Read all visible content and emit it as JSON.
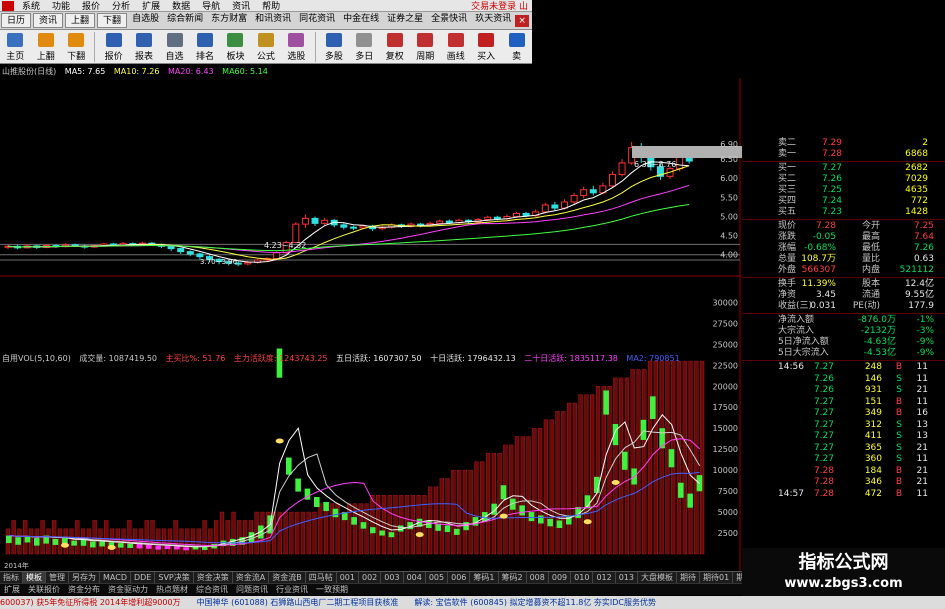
{
  "menubar": {
    "items": [
      "系统",
      "功能",
      "报价",
      "分析",
      "扩展",
      "数据",
      "导航",
      "资讯",
      "帮助"
    ],
    "right_text": "交易未登录  山"
  },
  "tabrow": {
    "tabs": [
      "日历",
      "资讯",
      "上翻",
      "下翻",
      "自选股",
      "综合新闻",
      "东方财富",
      "和讯资讯",
      "同花资讯",
      "中金在线",
      "证券之星",
      "全景快讯",
      "玖天资讯"
    ]
  },
  "toolbar": {
    "tools": [
      {
        "label": "主页",
        "icon": "home-icon",
        "color": "#3a70c0"
      },
      {
        "label": "上翻",
        "icon": "arrow-up-icon",
        "color": "#e08a10"
      },
      {
        "label": "下翻",
        "icon": "arrow-down-icon",
        "color": "#e08a10"
      },
      {
        "label": "报价",
        "icon": "quote-icon",
        "color": "#3060b0"
      },
      {
        "label": "报表",
        "icon": "report-icon",
        "color": "#3060b0"
      },
      {
        "label": "自选",
        "icon": "watchlist-icon",
        "color": "#607080"
      },
      {
        "label": "排名",
        "icon": "ranking-icon",
        "color": "#3060b0"
      },
      {
        "label": "板块",
        "icon": "sector-icon",
        "color": "#3a9040"
      },
      {
        "label": "公式",
        "icon": "formula-icon",
        "color": "#c09020"
      },
      {
        "label": "选股",
        "icon": "stock-picker-icon",
        "color": "#a050a0"
      },
      {
        "label": "多股",
        "icon": "multi-stock-icon",
        "color": "#3060b0"
      },
      {
        "label": "多日",
        "icon": "multi-day-icon",
        "color": "#909090"
      },
      {
        "label": "复权",
        "icon": "adjust-icon",
        "color": "#c03030"
      },
      {
        "label": "周期",
        "icon": "period-icon",
        "color": "#c03030"
      },
      {
        "label": "画线",
        "icon": "draw-line-icon",
        "color": "#c03030"
      },
      {
        "label": "买入",
        "icon": "buy-icon",
        "color": "#c02020"
      },
      {
        "label": "卖",
        "icon": "sell-icon",
        "color": "#2060c0"
      }
    ]
  },
  "ma_legend": {
    "name": "山推股份(日线)",
    "ma5": "MA5: 7.65",
    "ma10": "MA10: 7.26",
    "ma20": "MA20: 6.43",
    "ma60": "MA60: 5.14",
    "colors": {
      "ma5": "#ffffff",
      "ma10": "#ffff40",
      "ma20": "#ff40ff",
      "ma60": "#40ff40"
    }
  },
  "price_chart": {
    "y_ticks": [
      "6.90",
      "6.50",
      "6.00",
      "5.50",
      "5.00",
      "4.50",
      "4.00"
    ],
    "annotation_high": "6.38~8.76",
    "annotation_mid": "4.23~4.32",
    "annotation_low": "3.70~3.96",
    "candles": [
      {
        "o": 4.2,
        "c": 4.22,
        "h": 4.25,
        "l": 4.15
      },
      {
        "o": 4.22,
        "c": 4.18,
        "h": 4.26,
        "l": 4.14
      },
      {
        "o": 4.18,
        "c": 4.23,
        "h": 4.27,
        "l": 4.16
      },
      {
        "o": 4.23,
        "c": 4.19,
        "h": 4.26,
        "l": 4.15
      },
      {
        "o": 4.19,
        "c": 4.24,
        "h": 4.28,
        "l": 4.17
      },
      {
        "o": 4.24,
        "c": 4.21,
        "h": 4.27,
        "l": 4.18
      },
      {
        "o": 4.21,
        "c": 4.26,
        "h": 4.3,
        "l": 4.19
      },
      {
        "o": 4.26,
        "c": 4.23,
        "h": 4.29,
        "l": 4.2
      },
      {
        "o": 4.23,
        "c": 4.2,
        "h": 4.26,
        "l": 4.16
      },
      {
        "o": 4.2,
        "c": 4.24,
        "h": 4.27,
        "l": 4.18
      },
      {
        "o": 4.24,
        "c": 4.28,
        "h": 4.31,
        "l": 4.22
      },
      {
        "o": 4.28,
        "c": 4.25,
        "h": 4.31,
        "l": 4.22
      },
      {
        "o": 4.25,
        "c": 4.29,
        "h": 4.33,
        "l": 4.23
      },
      {
        "o": 4.29,
        "c": 4.26,
        "h": 4.32,
        "l": 4.23
      },
      {
        "o": 4.26,
        "c": 4.3,
        "h": 4.34,
        "l": 4.24
      },
      {
        "o": 4.3,
        "c": 4.27,
        "h": 4.33,
        "l": 4.24
      },
      {
        "o": 4.27,
        "c": 4.22,
        "h": 4.29,
        "l": 4.18
      },
      {
        "o": 4.22,
        "c": 4.16,
        "h": 4.24,
        "l": 4.1
      },
      {
        "o": 4.16,
        "c": 4.08,
        "h": 4.18,
        "l": 4.02
      },
      {
        "o": 4.08,
        "c": 4.02,
        "h": 4.11,
        "l": 3.96
      },
      {
        "o": 4.02,
        "c": 3.95,
        "h": 4.05,
        "l": 3.88
      },
      {
        "o": 3.95,
        "c": 3.88,
        "h": 3.98,
        "l": 3.8
      },
      {
        "o": 3.88,
        "c": 3.82,
        "h": 3.91,
        "l": 3.75
      },
      {
        "o": 3.82,
        "c": 3.78,
        "h": 3.86,
        "l": 3.72
      },
      {
        "o": 3.78,
        "c": 3.76,
        "h": 3.82,
        "l": 3.7
      },
      {
        "o": 3.76,
        "c": 3.8,
        "h": 3.84,
        "l": 3.72
      },
      {
        "o": 3.8,
        "c": 3.86,
        "h": 3.89,
        "l": 3.77
      },
      {
        "o": 3.86,
        "c": 3.9,
        "h": 3.94,
        "l": 3.83
      },
      {
        "o": 3.9,
        "c": 4.05,
        "h": 4.09,
        "l": 3.88
      },
      {
        "o": 4.05,
        "c": 4.32,
        "h": 4.36,
        "l": 4.02
      },
      {
        "o": 4.32,
        "c": 4.8,
        "h": 4.85,
        "l": 4.3
      },
      {
        "o": 4.8,
        "c": 4.95,
        "h": 5.05,
        "l": 4.7
      },
      {
        "o": 4.95,
        "c": 4.82,
        "h": 5.0,
        "l": 4.75
      },
      {
        "o": 4.82,
        "c": 4.9,
        "h": 4.96,
        "l": 4.78
      },
      {
        "o": 4.9,
        "c": 4.78,
        "h": 4.93,
        "l": 4.72
      },
      {
        "o": 4.78,
        "c": 4.72,
        "h": 4.82,
        "l": 4.66
      },
      {
        "o": 4.72,
        "c": 4.7,
        "h": 4.76,
        "l": 4.64
      },
      {
        "o": 4.7,
        "c": 4.75,
        "h": 4.79,
        "l": 4.66
      },
      {
        "o": 4.75,
        "c": 4.68,
        "h": 4.78,
        "l": 4.62
      },
      {
        "o": 4.68,
        "c": 4.72,
        "h": 4.76,
        "l": 4.64
      },
      {
        "o": 4.72,
        "c": 4.78,
        "h": 4.82,
        "l": 4.68
      },
      {
        "o": 4.78,
        "c": 4.74,
        "h": 4.81,
        "l": 4.7
      },
      {
        "o": 4.74,
        "c": 4.8,
        "h": 4.84,
        "l": 4.71
      },
      {
        "o": 4.8,
        "c": 4.76,
        "h": 4.83,
        "l": 4.72
      },
      {
        "o": 4.76,
        "c": 4.82,
        "h": 4.86,
        "l": 4.73
      },
      {
        "o": 4.82,
        "c": 4.88,
        "h": 4.92,
        "l": 4.79
      },
      {
        "o": 4.88,
        "c": 4.84,
        "h": 4.92,
        "l": 4.8
      },
      {
        "o": 4.84,
        "c": 4.9,
        "h": 4.94,
        "l": 4.81
      },
      {
        "o": 4.9,
        "c": 4.86,
        "h": 4.93,
        "l": 4.82
      },
      {
        "o": 4.86,
        "c": 4.92,
        "h": 4.96,
        "l": 4.83
      },
      {
        "o": 4.92,
        "c": 4.98,
        "h": 5.02,
        "l": 4.88
      },
      {
        "o": 4.98,
        "c": 4.94,
        "h": 5.02,
        "l": 4.9
      },
      {
        "o": 4.94,
        "c": 5.0,
        "h": 5.05,
        "l": 4.91
      },
      {
        "o": 5.0,
        "c": 5.08,
        "h": 5.12,
        "l": 4.97
      },
      {
        "o": 5.08,
        "c": 5.02,
        "h": 5.12,
        "l": 4.98
      },
      {
        "o": 5.02,
        "c": 5.12,
        "h": 5.18,
        "l": 4.99
      },
      {
        "o": 5.12,
        "c": 5.3,
        "h": 5.36,
        "l": 5.08
      },
      {
        "o": 5.3,
        "c": 5.22,
        "h": 5.38,
        "l": 5.15
      },
      {
        "o": 5.22,
        "c": 5.38,
        "h": 5.45,
        "l": 5.18
      },
      {
        "o": 5.38,
        "c": 5.55,
        "h": 5.62,
        "l": 5.32
      },
      {
        "o": 5.55,
        "c": 5.7,
        "h": 5.78,
        "l": 5.48
      },
      {
        "o": 5.7,
        "c": 5.62,
        "h": 5.8,
        "l": 5.55
      },
      {
        "o": 5.62,
        "c": 5.8,
        "h": 5.88,
        "l": 5.58
      },
      {
        "o": 5.8,
        "c": 6.1,
        "h": 6.18,
        "l": 5.76
      },
      {
        "o": 6.1,
        "c": 6.4,
        "h": 6.5,
        "l": 6.05
      },
      {
        "o": 6.4,
        "c": 6.8,
        "h": 6.95,
        "l": 6.35
      },
      {
        "o": 6.8,
        "c": 6.55,
        "h": 6.92,
        "l": 6.4
      },
      {
        "o": 6.55,
        "c": 6.3,
        "h": 6.62,
        "l": 6.2
      },
      {
        "o": 6.3,
        "c": 6.05,
        "h": 6.38,
        "l": 5.95
      },
      {
        "o": 6.05,
        "c": 6.25,
        "h": 6.32,
        "l": 5.98
      },
      {
        "o": 6.25,
        "c": 6.58,
        "h": 6.66,
        "l": 6.18
      },
      {
        "o": 6.58,
        "c": 6.45,
        "h": 6.7,
        "l": 6.38
      }
    ]
  },
  "volume_legend": {
    "name": "自用VOL(5,10,60)",
    "vol": "成交量: 1087419.50",
    "buy_ratio": "主买比%: 51.76",
    "active": "主力活跃度: 1243743.25",
    "five_day": "五日活跃: 1607307.50",
    "ten_day": "十日活跃: 1796432.13",
    "twenty_day": "二十日活跃: 1835117.38",
    "ma2": "MA2: 790851"
  },
  "volume_chart": {
    "y_ticks": [
      "30000",
      "27500",
      "25000",
      "22500",
      "20000",
      "17500",
      "15000",
      "12500",
      "10000",
      "7500",
      "5000",
      "2500"
    ],
    "x_label": "2014年",
    "red_bars": [
      3,
      4,
      3,
      4,
      3,
      3,
      4,
      3,
      4,
      3,
      3,
      3,
      4,
      3,
      3,
      4,
      3,
      4,
      3,
      3,
      3,
      4,
      3,
      3,
      4,
      4,
      3,
      3,
      3,
      4,
      3,
      3,
      3,
      3,
      4,
      3,
      4,
      5,
      4,
      5,
      4,
      4,
      4,
      5,
      5,
      5,
      5,
      5,
      5,
      5,
      5,
      5,
      5,
      5,
      6,
      6,
      6,
      6,
      5,
      6,
      6,
      6,
      6,
      7,
      7,
      7,
      7,
      7,
      7,
      7,
      7,
      7,
      7,
      8,
      8,
      9,
      9,
      10,
      10,
      10,
      10,
      11,
      11,
      12,
      12,
      12,
      13,
      13,
      14,
      14,
      14,
      15,
      15,
      16,
      16,
      17,
      17,
      18,
      18,
      19,
      19,
      19,
      20,
      20,
      20,
      21,
      21,
      21,
      22,
      22,
      22,
      23,
      23,
      23,
      23,
      23,
      23,
      23,
      23,
      23,
      23
    ],
    "green_bars": [
      {
        "v": 2.2,
        "h": 1.5
      },
      {
        "v": 2.0,
        "h": 1.5
      },
      {
        "v": 2.1,
        "h": 1.2
      },
      {
        "v": 1.9,
        "h": 1.5
      },
      {
        "v": 2.2,
        "h": 1.6
      },
      {
        "v": 1.8,
        "h": 1.2
      },
      {
        "v": 1.9,
        "h": 1.4
      },
      {
        "v": 1.6,
        "h": 1.0
      },
      {
        "v": 1.7,
        "h": 1.2
      },
      {
        "v": 1.5,
        "h": 1.2
      },
      {
        "v": 1.5,
        "h": 1.0
      },
      {
        "v": 1.4,
        "h": 1.0
      },
      {
        "v": 1.3,
        "h": 0.9
      },
      {
        "v": 1.2,
        "h": 0.8
      },
      {
        "v": 1.2,
        "h": 0.9
      },
      {
        "v": 1.1,
        "h": 0.8
      },
      {
        "v": 1.0,
        "h": 0.8
      },
      {
        "v": 1.0,
        "h": 0.7
      },
      {
        "v": 0.9,
        "h": 0.6
      },
      {
        "v": 0.8,
        "h": 0.6
      },
      {
        "v": 0.9,
        "h": 0.6
      },
      {
        "v": 0.9,
        "h": 0.7
      },
      {
        "v": 1.2,
        "h": 0.9
      },
      {
        "v": 1.6,
        "h": 1.1
      },
      {
        "v": 1.8,
        "h": 1.4
      },
      {
        "v": 2.0,
        "h": 1.5
      },
      {
        "v": 2.6,
        "h": 2.0
      },
      {
        "v": 3.4,
        "h": 2.6
      },
      {
        "v": 4.6,
        "h": 3.6
      },
      {
        "v": 24.5,
        "h": 5.8
      },
      {
        "v": 11.5,
        "h": 3.4
      },
      {
        "v": 9.0,
        "h": 2.6
      },
      {
        "v": 7.8,
        "h": 2.2
      },
      {
        "v": 6.8,
        "h": 2.0
      },
      {
        "v": 6.2,
        "h": 1.8
      },
      {
        "v": 5.4,
        "h": 1.7
      },
      {
        "v": 5.0,
        "h": 1.6
      },
      {
        "v": 4.4,
        "h": 1.5
      },
      {
        "v": 3.8,
        "h": 1.3
      },
      {
        "v": 3.2,
        "h": 1.2
      },
      {
        "v": 2.8,
        "h": 1.0
      },
      {
        "v": 2.6,
        "h": 1.0
      },
      {
        "v": 3.4,
        "h": 1.2
      },
      {
        "v": 3.8,
        "h": 1.4
      },
      {
        "v": 4.2,
        "h": 1.6
      },
      {
        "v": 4.0,
        "h": 1.5
      },
      {
        "v": 3.6,
        "h": 1.4
      },
      {
        "v": 3.4,
        "h": 1.3
      },
      {
        "v": 3.0,
        "h": 1.2
      },
      {
        "v": 3.8,
        "h": 1.6
      },
      {
        "v": 4.4,
        "h": 1.7
      },
      {
        "v": 5.0,
        "h": 1.9
      },
      {
        "v": 6.0,
        "h": 2.2
      },
      {
        "v": 8.2,
        "h": 2.8
      },
      {
        "v": 6.6,
        "h": 2.2
      },
      {
        "v": 5.8,
        "h": 2.0
      },
      {
        "v": 5.0,
        "h": 1.8
      },
      {
        "v": 4.6,
        "h": 1.6
      },
      {
        "v": 4.2,
        "h": 1.5
      },
      {
        "v": 4.0,
        "h": 1.5
      },
      {
        "v": 4.6,
        "h": 1.8
      },
      {
        "v": 5.6,
        "h": 2.2
      },
      {
        "v": 7.0,
        "h": 2.6
      },
      {
        "v": 9.2,
        "h": 3.2
      },
      {
        "v": 19.5,
        "h": 4.8
      },
      {
        "v": 15.5,
        "h": 4.2
      },
      {
        "v": 12.2,
        "h": 3.6
      },
      {
        "v": 10.2,
        "h": 3.2
      },
      {
        "v": 16.0,
        "h": 4.0
      },
      {
        "v": 18.8,
        "h": 4.5
      },
      {
        "v": 15.0,
        "h": 4.0
      },
      {
        "v": 12.5,
        "h": 3.6
      },
      {
        "v": 8.5,
        "h": 3.0
      },
      {
        "v": 7.2,
        "h": 2.8
      },
      {
        "v": 9.4,
        "h": 3.2
      }
    ],
    "magenta_bars_idx": [
      14,
      15,
      16,
      17,
      18,
      19
    ]
  },
  "quote_panel": {
    "asks": [
      {
        "label": "卖二",
        "price": "7.29",
        "vol": "2"
      },
      {
        "label": "卖一",
        "price": "7.28",
        "vol": "6868"
      }
    ],
    "bids": [
      {
        "label": "买一",
        "price": "7.27",
        "vol": "2682"
      },
      {
        "label": "买二",
        "price": "7.26",
        "vol": "7029"
      },
      {
        "label": "买三",
        "price": "7.25",
        "vol": "4635"
      },
      {
        "label": "买四",
        "price": "7.24",
        "vol": "772"
      },
      {
        "label": "买五",
        "price": "7.23",
        "vol": "1428"
      }
    ],
    "stats": [
      {
        "k": "现价",
        "v": "7.28",
        "k2": "今开",
        "v2": "7.25",
        "c1": "red",
        "c2": "red"
      },
      {
        "k": "涨跌",
        "v": "-0.05",
        "k2": "最高",
        "v2": "7.64",
        "c1": "green",
        "c2": "red"
      },
      {
        "k": "涨幅",
        "v": "-0.68%",
        "k2": "最低",
        "v2": "7.26",
        "c1": "green",
        "c2": "green"
      },
      {
        "k": "总量",
        "v": "108.7万",
        "k2": "量比",
        "v2": "0.63",
        "c1": "yellow",
        "c2": "white"
      },
      {
        "k": "外盘",
        "v": "566307",
        "k2": "内盘",
        "v2": "521112",
        "c1": "red",
        "c2": "green"
      }
    ],
    "stats2": [
      {
        "k": "换手",
        "v": "11.39%",
        "k2": "股本",
        "v2": "12.4亿",
        "c1": "yellow",
        "c2": "white"
      },
      {
        "k": "净资",
        "v": "3.45",
        "k2": "流通",
        "v2": "9.55亿",
        "c1": "white",
        "c2": "white"
      },
      {
        "k": "收益(三)",
        "v": "0.031",
        "k2": "PE(动)",
        "v2": "177.9",
        "c1": "white",
        "c2": "white"
      }
    ],
    "flows": [
      {
        "k": "净流入额",
        "v": "-876.0万",
        "p": "-1%"
      },
      {
        "k": "大宗流入",
        "v": "-2132万",
        "p": "-3%"
      },
      {
        "k": "5日净流入额",
        "v": "-4.63亿",
        "p": "-9%"
      },
      {
        "k": "5日大宗流入",
        "v": "-4.53亿",
        "p": "-9%"
      }
    ],
    "ticks": [
      {
        "t": "14:56",
        "p": "7.27",
        "v": "248",
        "s": "B",
        "n": "11",
        "pc": "green",
        "sc": "red"
      },
      {
        "t": "",
        "p": "7.26",
        "v": "146",
        "s": "S",
        "n": "11",
        "pc": "green",
        "sc": "green"
      },
      {
        "t": "",
        "p": "7.26",
        "v": "931",
        "s": "S",
        "n": "21",
        "pc": "green",
        "sc": "green"
      },
      {
        "t": "",
        "p": "7.27",
        "v": "151",
        "s": "B",
        "n": "11",
        "pc": "green",
        "sc": "red"
      },
      {
        "t": "",
        "p": "7.27",
        "v": "349",
        "s": "B",
        "n": "16",
        "pc": "green",
        "sc": "red"
      },
      {
        "t": "",
        "p": "7.27",
        "v": "312",
        "s": "S",
        "n": "13",
        "pc": "green",
        "sc": "green"
      },
      {
        "t": "",
        "p": "7.27",
        "v": "411",
        "s": "S",
        "n": "13",
        "pc": "green",
        "sc": "green"
      },
      {
        "t": "",
        "p": "7.27",
        "v": "365",
        "s": "S",
        "n": "21",
        "pc": "green",
        "sc": "green"
      },
      {
        "t": "",
        "p": "7.27",
        "v": "360",
        "s": "S",
        "n": "11",
        "pc": "green",
        "sc": "green"
      },
      {
        "t": "",
        "p": "7.28",
        "v": "184",
        "s": "B",
        "n": "21",
        "pc": "red",
        "sc": "red"
      },
      {
        "t": "",
        "p": "7.28",
        "v": "346",
        "s": "B",
        "n": "21",
        "pc": "red",
        "sc": "red"
      },
      {
        "t": "14:57",
        "p": "7.28",
        "v": "472",
        "s": "B",
        "n": "11",
        "pc": "red",
        "sc": "red"
      }
    ]
  },
  "bottom_tabs": [
    "指标",
    "模板",
    "管理",
    "另存为",
    "MACD",
    "DDE",
    "SVP决策",
    "资金决策",
    "资金流A",
    "资金流B",
    "四马帖",
    "001",
    "002",
    "003",
    "004",
    "005",
    "006",
    "筹码1",
    "筹码2",
    "008",
    "009",
    "010",
    "012",
    "013",
    "大盘模板",
    "期待",
    "期待01",
    "期待02"
  ],
  "bottom_tabs2": [
    "扩展",
    "关联报价",
    "资金分布",
    "资金驱动力",
    "热点题材",
    "综合资讯",
    "问题资讯",
    "行业资讯",
    "一致预期"
  ],
  "ticker": [
    {
      "text": "600037) 获5年免征所得税 2014年增利超9000万",
      "c": "tk-red"
    },
    {
      "text": "中国神华 (601088) 石狮路山西电厂二期工程项目获核准",
      "c": "tk-blue"
    },
    {
      "text": "解读: 宝信软件 (600845) 拟定增募资不超11.8亿 夯实IDC服务优势",
      "c": "tk-blue"
    }
  ],
  "watermark": {
    "line1": "指标公式网",
    "line2": "www.zbgs3.com"
  }
}
